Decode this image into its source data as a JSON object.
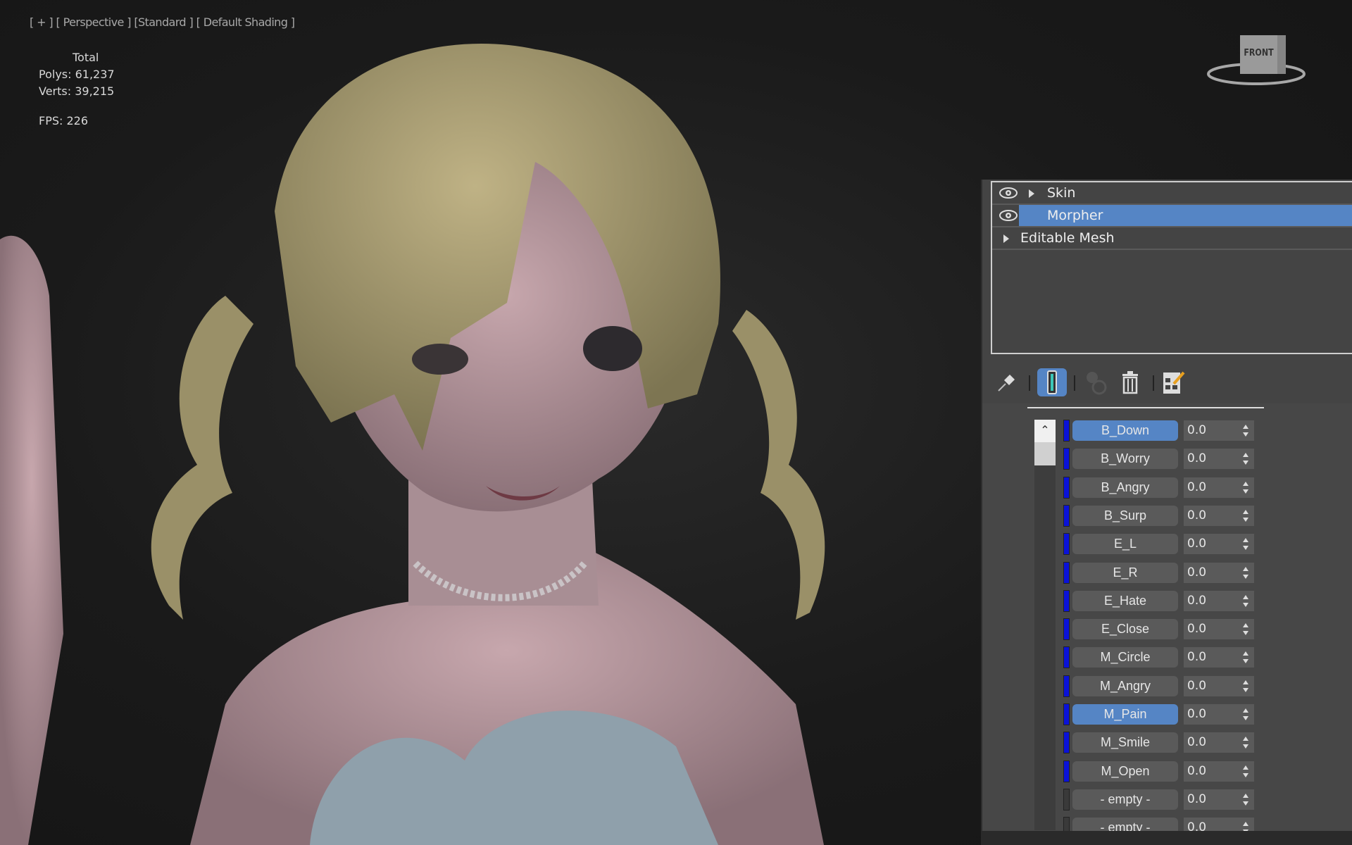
{
  "viewport": {
    "label": "[ + ] [ Perspective ] [Standard ] [ Default Shading ]",
    "stats": {
      "total_label": "Total",
      "polys": "Polys: 61,237",
      "verts": "Verts: 39,215"
    },
    "fps": "FPS:  226",
    "viewcube_face": "FRONT"
  },
  "modifier_stack": {
    "items": [
      {
        "label": "Skin",
        "visible_icon": "eye-icon",
        "expandable": true
      },
      {
        "label": "Morpher",
        "visible_icon": "eye-icon",
        "selected": true
      },
      {
        "label": "Editable Mesh",
        "expandable": true
      }
    ]
  },
  "toolbar": {
    "icons": [
      "pin-stack-icon",
      "show-end-result-icon",
      "make-unique-icon",
      "remove-modifier-icon",
      "configure-modifier-sets-icon"
    ]
  },
  "morph_channels": [
    {
      "name": "B_Down",
      "value": "0.0",
      "selected": true,
      "active": true
    },
    {
      "name": "B_Worry",
      "value": "0.0",
      "active": true
    },
    {
      "name": "B_Angry",
      "value": "0.0",
      "active": true
    },
    {
      "name": "B_Surp",
      "value": "0.0",
      "active": true
    },
    {
      "name": "E_L",
      "value": "0.0",
      "active": true
    },
    {
      "name": "E_R",
      "value": "0.0",
      "active": true
    },
    {
      "name": "E_Hate",
      "value": "0.0",
      "active": true
    },
    {
      "name": "E_Close",
      "value": "0.0",
      "active": true
    },
    {
      "name": "M_Circle",
      "value": "0.0",
      "active": true
    },
    {
      "name": "M_Angry",
      "value": "0.0",
      "active": true
    },
    {
      "name": "M_Pain",
      "value": "0.0",
      "selected": true,
      "active": true
    },
    {
      "name": "M_Smile",
      "value": "0.0",
      "active": true
    },
    {
      "name": "M_Open",
      "value": "0.0",
      "active": true
    },
    {
      "name": "- empty -",
      "value": "0.0",
      "active": false
    },
    {
      "name": "- empty -",
      "value": "0.0",
      "active": false
    }
  ],
  "colors": {
    "selection": "#5585c5",
    "channel_active": "#0a12d8",
    "panel": "#444444"
  }
}
